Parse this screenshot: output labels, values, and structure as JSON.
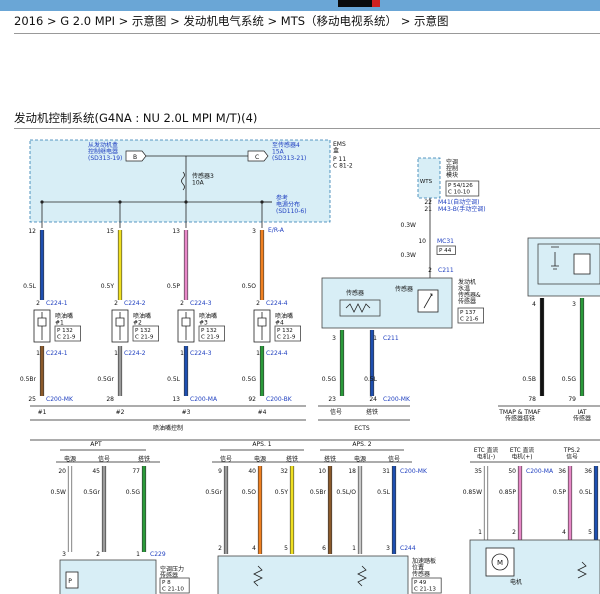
{
  "breadcrumb": "2016 > G 2.0 MPI > 示意图 > 发动机电气系统 > MTS（移动电视系统） > 示意图",
  "diagram_title": "发动机控制系统(G4NA : NU 2.0L MPI M/T)(4)",
  "ecm": {
    "name": "EMS\n盒",
    "conn": "P 11\nC 81-2",
    "left_sig": "从发动机盒\n控制继电器\n(SD313-19)",
    "left_tag": "B",
    "right_sig": "至传感器4\n15A\n(SD313-21)",
    "right_tag": "C",
    "fuse": "传感器3\n10A",
    "ref": "参考\n电源分布\n(SD110-6)"
  },
  "ac_module": {
    "tag": "WTS",
    "label": "空调\n控制\n模块",
    "conn": "P 54/126\nC 10-10",
    "pins": [
      "22",
      "21"
    ],
    "notes": [
      "M41(自动空调)",
      "M43-B(手动空调)"
    ]
  },
  "mc31": {
    "wire": "0.3W",
    "name": "MC31",
    "ref": "P 44",
    "wire2": "0.3W",
    "pin": "2",
    "conn": "C211"
  },
  "injectors": [
    {
      "top_pin": "12",
      "wire": "0.5L",
      "conn_pin": "2",
      "conn": "C224-1",
      "name": "喷油嘴\n#1",
      "ref": "P 132\nC 21-9",
      "conn2": "C224-1",
      "wire2": "0.5Br",
      "bot_pin": "25",
      "bot_conn": "C200-MK",
      "label": "#1",
      "color": "#1e4fb0",
      "color2": "#8b5a2b"
    },
    {
      "top_pin": "15",
      "wire": "0.5Y",
      "conn_pin": "2",
      "conn": "C224-2",
      "name": "喷油嘴\n#2",
      "ref": "P 132\nC 21-9",
      "conn2": "C224-2",
      "wire2": "0.5Gr",
      "bot_pin": "28",
      "bot_conn": "",
      "label": "#2",
      "color": "#f0e020",
      "color2": "#9a9a9a"
    },
    {
      "top_pin": "13",
      "wire": "0.5P",
      "conn_pin": "2",
      "conn": "C224-3",
      "name": "喷油嘴\n#3",
      "ref": "P 132\nC 21-9",
      "conn2": "C224-3",
      "wire2": "0.5L",
      "bot_pin": "13",
      "bot_conn": "C200-MA",
      "label": "#3",
      "color": "#e888c8",
      "color2": "#1e4fb0"
    },
    {
      "top_pin": "3",
      "wire": "0.5O",
      "conn_pin": "2",
      "conn": "C224-4",
      "name": "喷油嘴\n#4",
      "ref": "P 132\nC 21-9",
      "conn2": "C224-4",
      "wire2": "0.5G",
      "bot_pin": "92",
      "bot_conn": "C200-BK",
      "label": "#4",
      "color": "#f08020",
      "color2": "#2a9a3a"
    }
  ],
  "top_label_era": "E/R-A",
  "injector_group": "喷油嘴控制",
  "ects": {
    "sensor_label": "传感器",
    "part_label": "传感器",
    "name": "发动机\n水温\n传感器&\n传感器",
    "ref": "P 137\nC 21-6",
    "pins": [
      "3",
      "1"
    ],
    "conn": "C211",
    "wires": [
      "0.5G",
      "0.5L"
    ],
    "bot_pins": [
      "23",
      "24"
    ],
    "bot_conn": "C200-MK",
    "labels": [
      "信号",
      "搭铁"
    ],
    "group": "ECTS"
  },
  "tmap": {
    "pins": [
      "4",
      "3"
    ],
    "wires": [
      "0.5B",
      "0.5G"
    ],
    "bot_pins": [
      "78",
      "79"
    ],
    "group": "TMAP & TMAF\n传感器搭铁",
    "group2": "IAT\n传感器"
  },
  "apt": {
    "group": "APT",
    "cols": [
      "电源",
      "信号",
      "搭铁"
    ],
    "top_pins": [
      "20",
      "45",
      "77"
    ],
    "wires": [
      "0.5W",
      "0.5Gr",
      "0.5G"
    ],
    "bot_pins": [
      "3",
      "2",
      "1"
    ],
    "conn": "C229",
    "name": "空调压力\n传感器",
    "ref": "P 8\nC 21-10"
  },
  "aps": {
    "group1": "APS. 1",
    "group2": "APS. 2",
    "cols": [
      "信号",
      "电源",
      "搭铁",
      "搭铁",
      "电源",
      "信号"
    ],
    "top_pins": [
      "9",
      "40",
      "32",
      "10",
      "18",
      "31"
    ],
    "top_conn": "C200-MK",
    "wires": [
      "0.5Gr",
      "0.5O",
      "0.5Y",
      "0.5Br",
      "0.5L/O",
      "0.5L"
    ],
    "bot_pins": [
      "2",
      "4",
      "5",
      "6",
      "1",
      "3"
    ],
    "conn": "C244",
    "name": "加速踏板\n位置\n传感器",
    "ref": "P 49\nC 21-13"
  },
  "etc": {
    "cols": [
      "ETC 直流\n电机(-)",
      "ETC 直流\n电机(+)",
      "TPS.2\n信号"
    ],
    "top_pins": [
      "35",
      "50",
      "36",
      "36"
    ],
    "top_conn": "C200-MA",
    "wires": [
      "0.85W",
      "0.85P",
      "0.5P",
      "0.5L"
    ],
    "bot_pins": [
      "1",
      "2",
      "4",
      "5"
    ],
    "motor_label": "M",
    "motor_name": "电机"
  },
  "colors": {
    "blue": "#1e4fb0",
    "yellow": "#f0e020",
    "pink": "#e888c8",
    "orange": "#f08020",
    "green": "#2a9a3a",
    "brown": "#8b5a2b",
    "gray": "#9a9a9a",
    "white": "#ffffff",
    "black": "#111111",
    "box_fill": "#d8eef6",
    "ref_blue": "#2040c0"
  }
}
